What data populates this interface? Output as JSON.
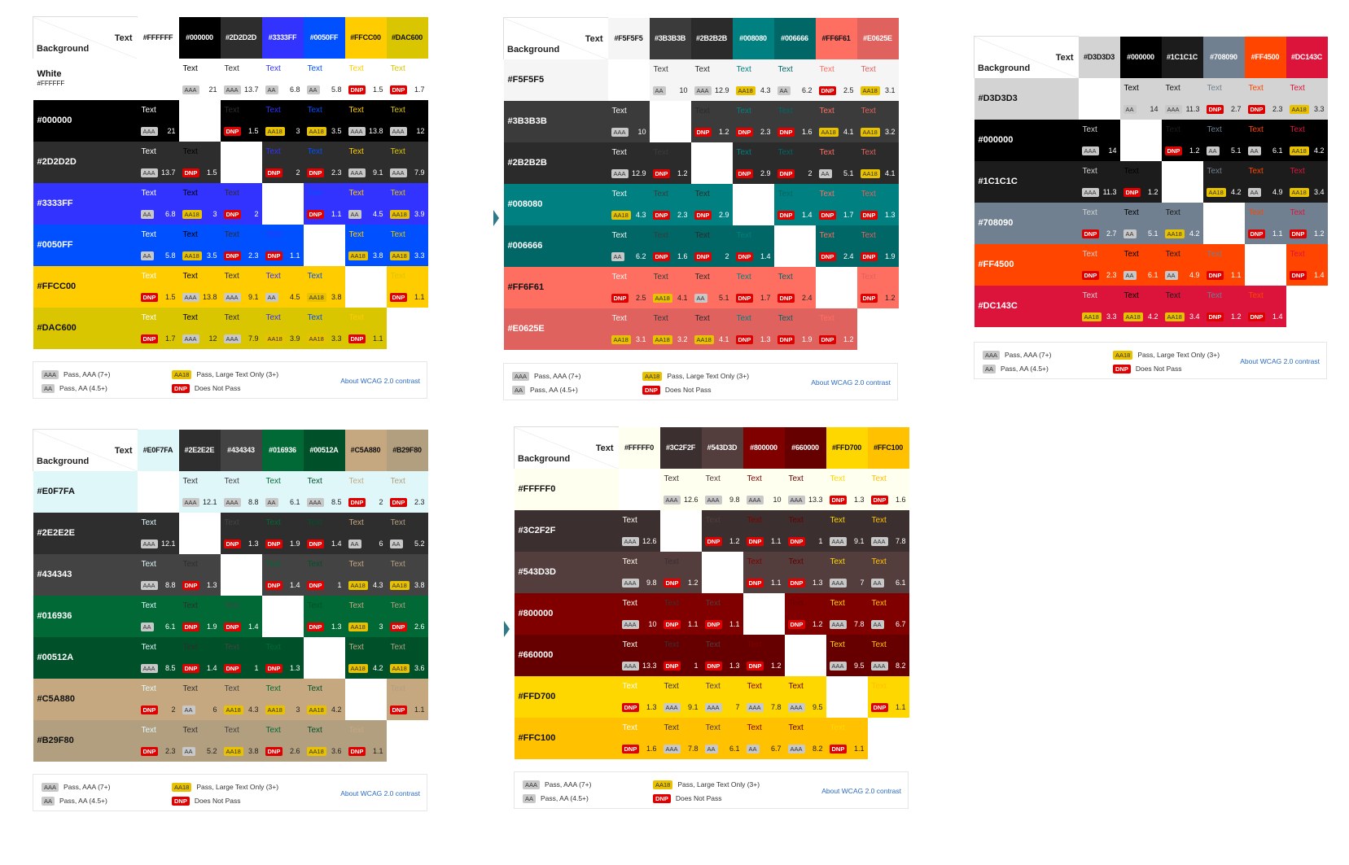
{
  "labels": {
    "text": "Text",
    "background": "Background"
  },
  "legend": {
    "aaa": "Pass, AAA (7+)",
    "aa": "Pass, AA (4.5+)",
    "aa18": "Pass, Large Text Only (3+)",
    "dnp": "Does Not Pass",
    "link": "About WCAG 2.0 contrast"
  },
  "badge_labels": {
    "AAA": "AAA",
    "AA": "AA",
    "AA18": "AA18",
    "DNP": "DNP"
  },
  "badge_colors": {
    "AAA": "#c8c8c8",
    "AA": "#c8c8c8",
    "AA18": "#e8c100",
    "DNP": "#e00000"
  },
  "palettes": [
    {
      "colors": [
        {
          "label": "#FFFFFF",
          "hex": "#FFFFFF",
          "row_label": "White",
          "row_sub": "#FFFFFF"
        },
        {
          "label": "#000000",
          "hex": "#000000"
        },
        {
          "label": "#2D2D2D",
          "hex": "#2D2D2D"
        },
        {
          "label": "#3333FF",
          "hex": "#3333FF"
        },
        {
          "label": "#0050FF",
          "hex": "#0050FF"
        },
        {
          "label": "#FFCC00",
          "hex": "#FFCC00"
        },
        {
          "label": "#DAC600",
          "hex": "#DAC600"
        }
      ],
      "rows": [
        [
          null,
          [
            "AAA",
            "21"
          ],
          [
            "AAA",
            "13.7"
          ],
          [
            "AA",
            "6.8"
          ],
          [
            "AA",
            "5.8"
          ],
          [
            "DNP",
            "1.5"
          ],
          [
            "DNP",
            "1.7"
          ]
        ],
        [
          [
            "AAA",
            "21"
          ],
          null,
          [
            "DNP",
            "1.5"
          ],
          [
            "AA18",
            "3"
          ],
          [
            "AA18",
            "3.5"
          ],
          [
            "AAA",
            "13.8"
          ],
          [
            "AAA",
            "12"
          ]
        ],
        [
          [
            "AAA",
            "13.7"
          ],
          [
            "DNP",
            "1.5"
          ],
          null,
          [
            "DNP",
            "2"
          ],
          [
            "DNP",
            "2.3"
          ],
          [
            "AAA",
            "9.1"
          ],
          [
            "AAA",
            "7.9"
          ]
        ],
        [
          [
            "AA",
            "6.8"
          ],
          [
            "AA18",
            "3"
          ],
          [
            "DNP",
            "2"
          ],
          null,
          [
            "DNP",
            "1.1"
          ],
          [
            "AA",
            "4.5"
          ],
          [
            "AA18",
            "3.9"
          ]
        ],
        [
          [
            "AA",
            "5.8"
          ],
          [
            "AA18",
            "3.5"
          ],
          [
            "DNP",
            "2.3"
          ],
          [
            "DNP",
            "1.1"
          ],
          null,
          [
            "AA18",
            "3.8"
          ],
          [
            "AA18",
            "3.3"
          ]
        ],
        [
          [
            "DNP",
            "1.5"
          ],
          [
            "AAA",
            "13.8"
          ],
          [
            "AAA",
            "9.1"
          ],
          [
            "AA",
            "4.5"
          ],
          [
            "AA18",
            "3.8"
          ],
          null,
          [
            "DNP",
            "1.1"
          ]
        ],
        [
          [
            "DNP",
            "1.7"
          ],
          [
            "AAA",
            "12"
          ],
          [
            "AAA",
            "7.9"
          ],
          [
            "AA18",
            "3.9"
          ],
          [
            "AA18",
            "3.3"
          ],
          [
            "DNP",
            "1.1"
          ],
          null
        ]
      ]
    },
    {
      "colors": [
        {
          "label": "#F5F5F5",
          "hex": "#F5F5F5"
        },
        {
          "label": "#3B3B3B",
          "hex": "#3B3B3B"
        },
        {
          "label": "#2B2B2B",
          "hex": "#2B2B2B"
        },
        {
          "label": "#008080",
          "hex": "#008080"
        },
        {
          "label": "#006666",
          "hex": "#006666"
        },
        {
          "label": "#FF6F61",
          "hex": "#FF6F61"
        },
        {
          "label": "#E0625E",
          "hex": "#E0625E"
        }
      ],
      "rows": [
        [
          null,
          [
            "AA",
            "10"
          ],
          [
            "AAA",
            "12.9"
          ],
          [
            "AA18",
            "4.3"
          ],
          [
            "AA",
            "6.2"
          ],
          [
            "DNP",
            "2.5"
          ],
          [
            "AA18",
            "3.1"
          ]
        ],
        [
          [
            "AAA",
            "10"
          ],
          null,
          [
            "DNP",
            "1.2"
          ],
          [
            "DNP",
            "2.3"
          ],
          [
            "DNP",
            "1.6"
          ],
          [
            "AA18",
            "4.1"
          ],
          [
            "AA18",
            "3.2"
          ]
        ],
        [
          [
            "AAA",
            "12.9"
          ],
          [
            "DNP",
            "1.2"
          ],
          null,
          [
            "DNP",
            "2.9"
          ],
          [
            "DNP",
            "2"
          ],
          [
            "AA",
            "5.1"
          ],
          [
            "AA18",
            "4.1"
          ]
        ],
        [
          [
            "AA18",
            "4.3"
          ],
          [
            "DNP",
            "2.3"
          ],
          [
            "DNP",
            "2.9"
          ],
          null,
          [
            "DNP",
            "1.4"
          ],
          [
            "DNP",
            "1.7"
          ],
          [
            "DNP",
            "1.3"
          ]
        ],
        [
          [
            "AA",
            "6.2"
          ],
          [
            "DNP",
            "1.6"
          ],
          [
            "DNP",
            "2"
          ],
          [
            "DNP",
            "1.4"
          ],
          null,
          [
            "DNP",
            "2.4"
          ],
          [
            "DNP",
            "1.9"
          ]
        ],
        [
          [
            "DNP",
            "2.5"
          ],
          [
            "AA18",
            "4.1"
          ],
          [
            "AA",
            "5.1"
          ],
          [
            "DNP",
            "1.7"
          ],
          [
            "DNP",
            "2.4"
          ],
          null,
          [
            "DNP",
            "1.2"
          ]
        ],
        [
          [
            "AA18",
            "3.1"
          ],
          [
            "AA18",
            "3.2"
          ],
          [
            "AA18",
            "4.1"
          ],
          [
            "DNP",
            "1.3"
          ],
          [
            "DNP",
            "1.9"
          ],
          [
            "DNP",
            "1.2"
          ],
          null
        ]
      ]
    },
    {
      "colors": [
        {
          "label": "#D3D3D3",
          "hex": "#D3D3D3"
        },
        {
          "label": "#000000",
          "hex": "#000000"
        },
        {
          "label": "#1C1C1C",
          "hex": "#1C1C1C"
        },
        {
          "label": "#708090",
          "hex": "#708090"
        },
        {
          "label": "#FF4500",
          "hex": "#FF4500"
        },
        {
          "label": "#DC143C",
          "hex": "#DC143C"
        }
      ],
      "rows": [
        [
          null,
          [
            "AA",
            "14"
          ],
          [
            "AAA",
            "11.3"
          ],
          [
            "DNP",
            "2.7"
          ],
          [
            "DNP",
            "2.3"
          ],
          [
            "AA18",
            "3.3"
          ]
        ],
        [
          [
            "AAA",
            "14"
          ],
          null,
          [
            "DNP",
            "1.2"
          ],
          [
            "AA",
            "5.1"
          ],
          [
            "AA",
            "6.1"
          ],
          [
            "AA18",
            "4.2"
          ]
        ],
        [
          [
            "AAA",
            "11.3"
          ],
          [
            "DNP",
            "1.2"
          ],
          null,
          [
            "AA18",
            "4.2"
          ],
          [
            "AA",
            "4.9"
          ],
          [
            "AA18",
            "3.4"
          ]
        ],
        [
          [
            "DNP",
            "2.7"
          ],
          [
            "AA",
            "5.1"
          ],
          [
            "AA18",
            "4.2"
          ],
          null,
          [
            "DNP",
            "1.1"
          ],
          [
            "DNP",
            "1.2"
          ]
        ],
        [
          [
            "DNP",
            "2.3"
          ],
          [
            "AA",
            "6.1"
          ],
          [
            "AA",
            "4.9"
          ],
          [
            "DNP",
            "1.1"
          ],
          null,
          [
            "DNP",
            "1.4"
          ]
        ],
        [
          [
            "AA18",
            "3.3"
          ],
          [
            "AA18",
            "4.2"
          ],
          [
            "AA18",
            "3.4"
          ],
          [
            "DNP",
            "1.2"
          ],
          [
            "DNP",
            "1.4"
          ],
          null
        ]
      ]
    },
    {
      "colors": [
        {
          "label": "#E0F7FA",
          "hex": "#E0F7FA"
        },
        {
          "label": "#2E2E2E",
          "hex": "#2E2E2E"
        },
        {
          "label": "#434343",
          "hex": "#434343"
        },
        {
          "label": "#016936",
          "hex": "#016936"
        },
        {
          "label": "#00512A",
          "hex": "#00512A"
        },
        {
          "label": "#C5A880",
          "hex": "#C5A880"
        },
        {
          "label": "#B29F80",
          "hex": "#B29F80"
        }
      ],
      "rows": [
        [
          null,
          [
            "AAA",
            "12.1"
          ],
          [
            "AAA",
            "8.8"
          ],
          [
            "AA",
            "6.1"
          ],
          [
            "AAA",
            "8.5"
          ],
          [
            "DNP",
            "2"
          ],
          [
            "DNP",
            "2.3"
          ]
        ],
        [
          [
            "AAA",
            "12.1"
          ],
          null,
          [
            "DNP",
            "1.3"
          ],
          [
            "DNP",
            "1.9"
          ],
          [
            "DNP",
            "1.4"
          ],
          [
            "AA",
            "6"
          ],
          [
            "AA",
            "5.2"
          ]
        ],
        [
          [
            "AAA",
            "8.8"
          ],
          [
            "DNP",
            "1.3"
          ],
          null,
          [
            "DNP",
            "1.4"
          ],
          [
            "DNP",
            "1"
          ],
          [
            "AA18",
            "4.3"
          ],
          [
            "AA18",
            "3.8"
          ]
        ],
        [
          [
            "AA",
            "6.1"
          ],
          [
            "DNP",
            "1.9"
          ],
          [
            "DNP",
            "1.4"
          ],
          null,
          [
            "DNP",
            "1.3"
          ],
          [
            "AA18",
            "3"
          ],
          [
            "DNP",
            "2.6"
          ]
        ],
        [
          [
            "AAA",
            "8.5"
          ],
          [
            "DNP",
            "1.4"
          ],
          [
            "DNP",
            "1"
          ],
          [
            "DNP",
            "1.3"
          ],
          null,
          [
            "AA18",
            "4.2"
          ],
          [
            "AA18",
            "3.6"
          ]
        ],
        [
          [
            "DNP",
            "2"
          ],
          [
            "AA",
            "6"
          ],
          [
            "AA18",
            "4.3"
          ],
          [
            "AA18",
            "3"
          ],
          [
            "AA18",
            "4.2"
          ],
          null,
          [
            "DNP",
            "1.1"
          ]
        ],
        [
          [
            "DNP",
            "2.3"
          ],
          [
            "AA",
            "5.2"
          ],
          [
            "AA18",
            "3.8"
          ],
          [
            "DNP",
            "2.6"
          ],
          [
            "AA18",
            "3.6"
          ],
          [
            "DNP",
            "1.1"
          ],
          null
        ]
      ]
    },
    {
      "colors": [
        {
          "label": "#FFFFF0",
          "hex": "#FFFFF0"
        },
        {
          "label": "#3C2F2F",
          "hex": "#3C2F2F"
        },
        {
          "label": "#543D3D",
          "hex": "#543D3D"
        },
        {
          "label": "#800000",
          "hex": "#800000"
        },
        {
          "label": "#660000",
          "hex": "#660000"
        },
        {
          "label": "#FFD700",
          "hex": "#FFD700"
        },
        {
          "label": "#FFC100",
          "hex": "#FFC100"
        }
      ],
      "rows": [
        [
          null,
          [
            "AAA",
            "12.6"
          ],
          [
            "AAA",
            "9.8"
          ],
          [
            "AAA",
            "10"
          ],
          [
            "AAA",
            "13.3"
          ],
          [
            "DNP",
            "1.3"
          ],
          [
            "DNP",
            "1.6"
          ]
        ],
        [
          [
            "AAA",
            "12.6"
          ],
          null,
          [
            "DNP",
            "1.2"
          ],
          [
            "DNP",
            "1.1"
          ],
          [
            "DNP",
            "1"
          ],
          [
            "AAA",
            "9.1"
          ],
          [
            "AAA",
            "7.8"
          ]
        ],
        [
          [
            "AAA",
            "9.8"
          ],
          [
            "DNP",
            "1.2"
          ],
          null,
          [
            "DNP",
            "1.1"
          ],
          [
            "DNP",
            "1.3"
          ],
          [
            "AAA",
            "7"
          ],
          [
            "AA",
            "6.1"
          ]
        ],
        [
          [
            "AAA",
            "10"
          ],
          [
            "DNP",
            "1.1"
          ],
          [
            "DNP",
            "1.1"
          ],
          null,
          [
            "DNP",
            "1.2"
          ],
          [
            "AAA",
            "7.8"
          ],
          [
            "AA",
            "6.7"
          ]
        ],
        [
          [
            "AAA",
            "13.3"
          ],
          [
            "DNP",
            "1"
          ],
          [
            "DNP",
            "1.3"
          ],
          [
            "DNP",
            "1.2"
          ],
          null,
          [
            "AAA",
            "9.5"
          ],
          [
            "AAA",
            "8.2"
          ]
        ],
        [
          [
            "DNP",
            "1.3"
          ],
          [
            "AAA",
            "9.1"
          ],
          [
            "AAA",
            "7"
          ],
          [
            "AAA",
            "7.8"
          ],
          [
            "AAA",
            "9.5"
          ],
          null,
          [
            "DNP",
            "1.1"
          ]
        ],
        [
          [
            "DNP",
            "1.6"
          ],
          [
            "AAA",
            "7.8"
          ],
          [
            "AA",
            "6.1"
          ],
          [
            "AA",
            "6.7"
          ],
          [
            "AAA",
            "8.2"
          ],
          [
            "DNP",
            "1.1"
          ],
          null
        ]
      ]
    }
  ]
}
